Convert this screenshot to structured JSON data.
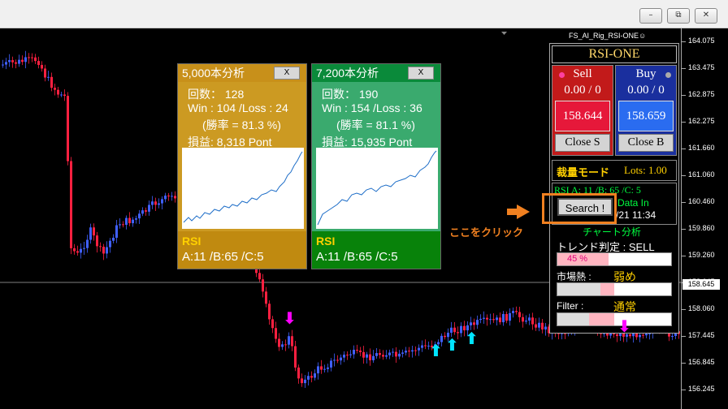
{
  "window": {
    "minimize": "–",
    "restore": "⧉",
    "close": "✕"
  },
  "ea_name": "FS_AI_Rig_RSI-ONE☺",
  "axis_ticks": [
    "164.075",
    "163.475",
    "162.875",
    "162.275",
    "161.660",
    "161.060",
    "160.460",
    "159.860",
    "159.260",
    "158.645",
    "158.060",
    "157.445",
    "156.845",
    "156.245"
  ],
  "current_price": "158.645",
  "card1": {
    "title": "5,000本分析",
    "close": "X",
    "count_label": "回数： 128",
    "winloss": "Win : 104 /Loss : 24",
    "rate": "(勝率 = 81.3 %)",
    "profit": "損益: 8,318 Pont",
    "rsi_title": "RSI",
    "rsi_values": "A:11 /B:65 /C:5"
  },
  "card2": {
    "title": "7,200本分析",
    "close": "X",
    "count_label": "回数： 190",
    "winloss": "Win : 154 /Loss : 36",
    "rate": "(勝率 = 81.1 %)",
    "profit": "損益: 15,935 Pont",
    "rsi_title": "RSI",
    "rsi_values": "A:11 /B:65 /C:5"
  },
  "panel": {
    "title": "RSI-ONE",
    "sell": {
      "label": "Sell",
      "count": "0.00 / 0",
      "price": "158.644",
      "close": "Close S"
    },
    "buy": {
      "label": "Buy",
      "count": "0.00 / 0",
      "price": "158.659",
      "close": "Close B"
    },
    "lot_mode": "裁量モード",
    "lots": "Lots: 1.00",
    "rsi_info": "RSI  A: 11 /B: 65 /C: 5",
    "data_in": "Data In",
    "date_time": "/21 11:34",
    "search": "Search !",
    "chart_analysis": "チャート分析",
    "trend": "トレンド判定 : SELL",
    "trend_pct": "45 %",
    "trend_level": 0.45,
    "heat_label": "市場熱 :",
    "heat_value": "弱め",
    "filter_label": "Filter :",
    "filter_value": "通常"
  },
  "callout": "ここをクリック",
  "colors": {
    "accent": "#f08020",
    "sell": "#c21a1a",
    "buy": "#1a2f9e"
  }
}
